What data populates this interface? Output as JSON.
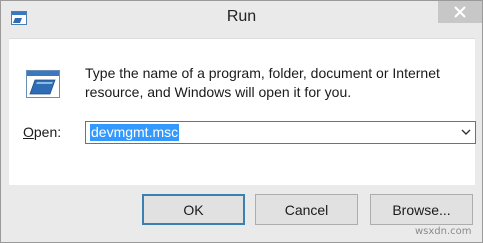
{
  "window": {
    "title": "Run",
    "close_glyph": "✕"
  },
  "icons": {
    "title_icon": "run-dialog-icon",
    "main_icon": "run-dialog-icon",
    "close": "close-icon",
    "dropdown": "chevron-down-icon"
  },
  "content": {
    "description": "Type the name of a program, folder, document or Internet resource, and Windows will open it for you.",
    "open_label_accel": "O",
    "open_label_rest": "pen:",
    "open_value": "devmgmt.msc"
  },
  "buttons": {
    "ok": "OK",
    "cancel": "Cancel",
    "browse": "Browse..."
  },
  "colors": {
    "selection": "#3399ff",
    "focus_border": "#3c7fb1",
    "background": "#eaeaea"
  },
  "watermark": "wsxdn.com"
}
